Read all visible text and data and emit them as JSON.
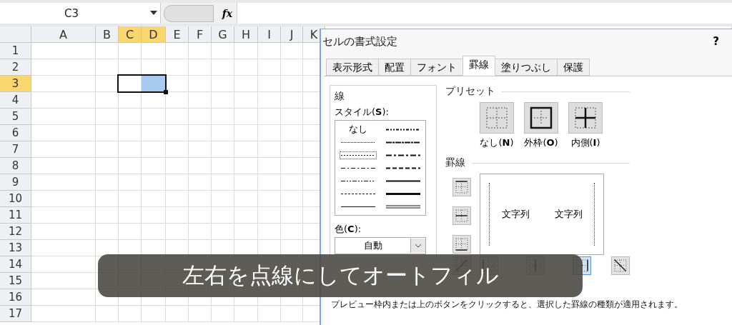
{
  "formula_bar": {
    "name_box": "C3",
    "fx": "fx"
  },
  "sheet": {
    "columns": [
      {
        "label": "A",
        "selected": false
      },
      {
        "label": "B",
        "selected": false
      },
      {
        "label": "C",
        "selected": true
      },
      {
        "label": "D",
        "selected": true
      },
      {
        "label": "E",
        "selected": false
      },
      {
        "label": "F",
        "selected": false
      },
      {
        "label": "G",
        "selected": false
      },
      {
        "label": "H",
        "selected": false
      },
      {
        "label": "I",
        "selected": false
      },
      {
        "label": "J",
        "selected": false
      },
      {
        "label": "K",
        "selected": false
      }
    ],
    "rows": [
      {
        "label": "1",
        "selected": false
      },
      {
        "label": "2",
        "selected": false
      },
      {
        "label": "3",
        "selected": true
      },
      {
        "label": "4",
        "selected": false
      },
      {
        "label": "5",
        "selected": false
      },
      {
        "label": "6",
        "selected": false
      },
      {
        "label": "7",
        "selected": false
      },
      {
        "label": "8",
        "selected": false
      },
      {
        "label": "9",
        "selected": false
      },
      {
        "label": "10",
        "selected": false
      },
      {
        "label": "11",
        "selected": false
      },
      {
        "label": "12",
        "selected": false
      },
      {
        "label": "13",
        "selected": false
      },
      {
        "label": "14",
        "selected": false
      },
      {
        "label": "15",
        "selected": false
      },
      {
        "label": "16",
        "selected": false
      },
      {
        "label": "17",
        "selected": false
      }
    ]
  },
  "dialog": {
    "title": "セルの書式設定",
    "help": "?",
    "tabs": [
      {
        "label": "表示形式",
        "selected": false
      },
      {
        "label": "配置",
        "selected": false
      },
      {
        "label": "フォント",
        "selected": false
      },
      {
        "label": "罫線",
        "selected": true
      },
      {
        "label": "塗りつぶし",
        "selected": false
      },
      {
        "label": "保護",
        "selected": false
      }
    ],
    "line_group": {
      "title": "線",
      "style_label": "スタイル(**S**):",
      "none_label": "なし",
      "styles": [
        {
          "kind": "none",
          "selected": false
        },
        {
          "kind": "dashdotdot",
          "selected": false
        },
        {
          "kind": "hair",
          "selected": false
        },
        {
          "kind": "slantdash",
          "selected": false
        },
        {
          "kind": "dotted",
          "selected": true
        },
        {
          "kind": "medium-dashdot",
          "selected": false
        },
        {
          "kind": "dashdot",
          "selected": false
        },
        {
          "kind": "medium-dashed",
          "selected": false
        },
        {
          "kind": "dashdotdot-thin",
          "selected": false
        },
        {
          "kind": "medium",
          "selected": false
        },
        {
          "kind": "dashed",
          "selected": false
        },
        {
          "kind": "thick",
          "selected": false
        },
        {
          "kind": "thin",
          "selected": false
        },
        {
          "kind": "double",
          "selected": false
        }
      ],
      "color_label": "色(**C**):",
      "color_value": "自動"
    },
    "preset": {
      "title": "プリセット",
      "buttons": [
        {
          "kind": "none",
          "label": "なし(**N**)"
        },
        {
          "kind": "outline",
          "label": "外枠(**O**)"
        },
        {
          "kind": "inside",
          "label": "内側(**I**)"
        }
      ]
    },
    "border": {
      "title": "罫線",
      "side_buttons": [
        {
          "kind": "top",
          "selected": false
        },
        {
          "kind": "middle",
          "selected": false
        },
        {
          "kind": "bottom",
          "selected": false
        }
      ],
      "bottom_buttons": [
        {
          "kind": "diag-up",
          "selected": false
        },
        {
          "kind": "left",
          "selected": false
        },
        {
          "kind": "center",
          "selected": false
        },
        {
          "kind": "right",
          "selected": true
        },
        {
          "kind": "diag-down",
          "selected": false
        }
      ],
      "preview": {
        "texts": [
          "文字列",
          "文字列"
        ],
        "left_dotted": true,
        "right_dotted": true
      },
      "hint": "プレビュー枠内または上のボタンをクリックすると、選択した罫線の種類が適用されます。"
    }
  },
  "caption": "左右を点線にしてオートフィル"
}
